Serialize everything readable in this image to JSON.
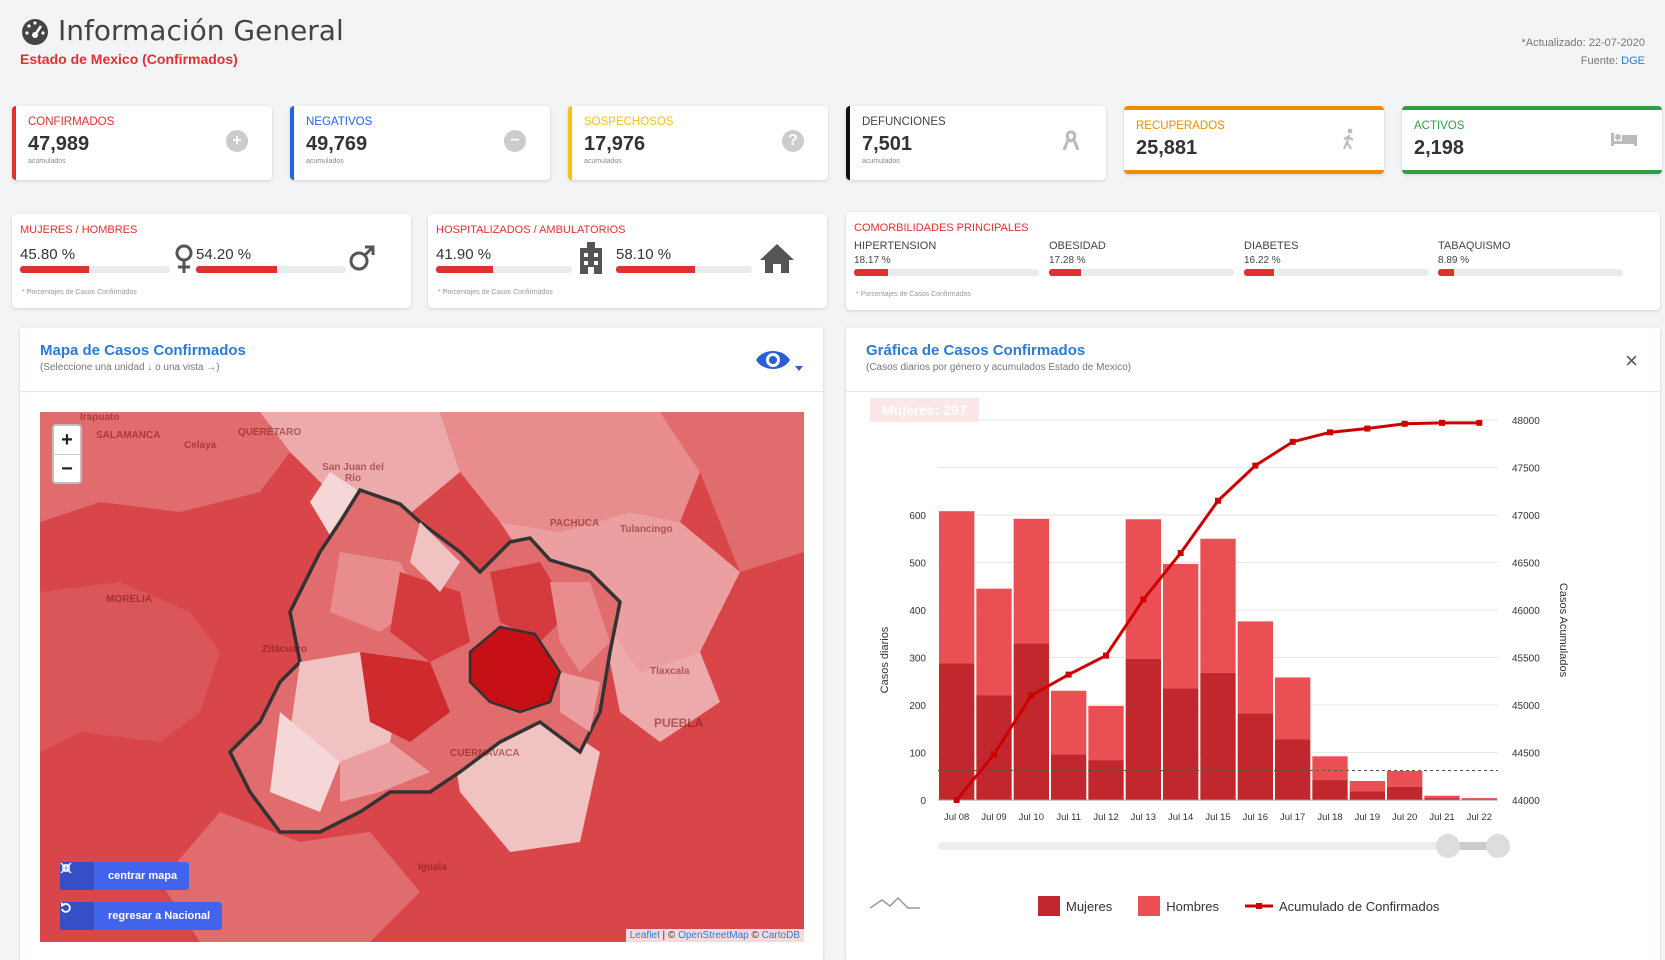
{
  "header": {
    "title": "Información General",
    "subtitle": "Estado de Mexico (Confirmados)",
    "updated": "*Actualizado: 22-07-2020",
    "source_prefix": "Fuente: ",
    "source": "DGE"
  },
  "stats": [
    {
      "label": "CONFIRMADOS",
      "value": "47,989",
      "sub": "acumulados",
      "color": "#e03131",
      "icon": "plus-circle-icon"
    },
    {
      "label": "NEGATIVOS",
      "value": "49,769",
      "sub": "acumulados",
      "color": "#2563eb",
      "icon": "minus-circle-icon"
    },
    {
      "label": "SOSPECHOSOS",
      "value": "17,976",
      "sub": "acumulados",
      "color": "#f5c211",
      "icon": "question-circle-icon"
    },
    {
      "label": "DEFUNCIONES",
      "value": "7,501",
      "sub": "acumulados",
      "color": "#111111",
      "icon": "ribbon-icon"
    },
    {
      "label": "RECUPERADOS",
      "value": "25,881",
      "color": "#f08c00",
      "icon": "walking-person-icon"
    },
    {
      "label": "ACTIVOS",
      "value": "2,198",
      "color": "#2f9e44",
      "icon": "bed-icon"
    }
  ],
  "gender": {
    "heading": "MUJERES / HOMBRES",
    "women_pct": "45.80 %",
    "women_value": 45.8,
    "men_pct": "54.20 %",
    "men_value": 54.2,
    "note": "* Porcentajes  de Casos Confirmados"
  },
  "hospital": {
    "heading": "HOSPITALIZADOS / AMBULATORIOS",
    "hosp_pct": "41.90 %",
    "hosp_value": 41.9,
    "amb_pct": "58.10 %",
    "amb_value": 58.1,
    "note": "* Porcentajes  de Casos Confirmados"
  },
  "comorbidities": {
    "heading": "COMORBILIDADES PRINCIPALES",
    "items": [
      {
        "name": "HIPERTENSION",
        "pct": "18.17 %",
        "value": 18.17
      },
      {
        "name": "OBESIDAD",
        "pct": "17.28 %",
        "value": 17.28
      },
      {
        "name": "DIABETES",
        "pct": "16.22 %",
        "value": 16.22
      },
      {
        "name": "TABAQUISMO",
        "pct": "8.89 %",
        "value": 8.89
      }
    ],
    "note": "* Porcentajes  de Casos Confirmados"
  },
  "map_panel": {
    "title": "Mapa de Casos Confirmados",
    "subtitle": "(Seleccione una unidad ↓ o una vista →)",
    "zoom_in": "+",
    "zoom_out": "−",
    "btn_center": "centrar mapa",
    "btn_national": "regresar a Nacional",
    "attribution_leaflet": "Leaflet",
    "attribution_rest": " | © ",
    "attribution_osm": "OpenStreetMap",
    "attribution_sep": " © ",
    "attribution_carto": "CartoDB",
    "places": [
      "Irapuato",
      "SALAMANCA",
      "QUERÉTARO",
      "Celaya",
      "San Juan del Río",
      "PACHUCA",
      "Tulancingo",
      "MORELIA",
      "Zitácuaro",
      "Tlaxcala",
      "PUEBLA",
      "CUERNAVACA",
      "Iguala"
    ]
  },
  "chart_panel": {
    "title": "Gráfica de Casos Confirmados",
    "subtitle": "(Casos diarios por género y acumulados Estado de Mexico)",
    "tooltip": "Mujeres: 297",
    "close": "×"
  },
  "chart_data": {
    "type": "bar",
    "categories": [
      "Jul 08",
      "Jul 09",
      "Jul 10",
      "Jul 11",
      "Jul 12",
      "Jul 13",
      "Jul 14",
      "Jul 15",
      "Jul 16",
      "Jul 17",
      "Jul 18",
      "Jul 19",
      "Jul 20",
      "Jul 21",
      "Jul 22"
    ],
    "series": [
      {
        "name": "Mujeres",
        "type": "bar",
        "stacked": true,
        "color": "#c1272d",
        "values": [
          288,
          220,
          330,
          96,
          84,
          297,
          235,
          268,
          182,
          128,
          42,
          18,
          28,
          4,
          2
        ]
      },
      {
        "name": "Hombres",
        "type": "bar",
        "stacked": true,
        "color": "#ea4f53",
        "values": [
          320,
          225,
          262,
          134,
          114,
          294,
          262,
          282,
          194,
          130,
          50,
          22,
          33,
          5,
          2
        ]
      },
      {
        "name": "Acumulado de Confirmados",
        "type": "line",
        "axis": "right",
        "color": "#cc0000",
        "values": [
          44000,
          44480,
          45100,
          45320,
          45520,
          46110,
          46600,
          47150,
          47520,
          47770,
          47870,
          47910,
          47960,
          47970,
          47970
        ]
      }
    ],
    "ylabel": "Casos diarios",
    "ylim": [
      0,
      800
    ],
    "y_ticks": [
      0,
      100,
      200,
      300,
      400,
      500,
      600
    ],
    "y2label": "Casos Acumulados",
    "y2lim": [
      44000,
      48000
    ],
    "y2_ticks": [
      44000,
      44500,
      45000,
      45500,
      46000,
      46500,
      47000,
      47500,
      48000
    ],
    "reference_line": 62,
    "legend": "bottom"
  }
}
